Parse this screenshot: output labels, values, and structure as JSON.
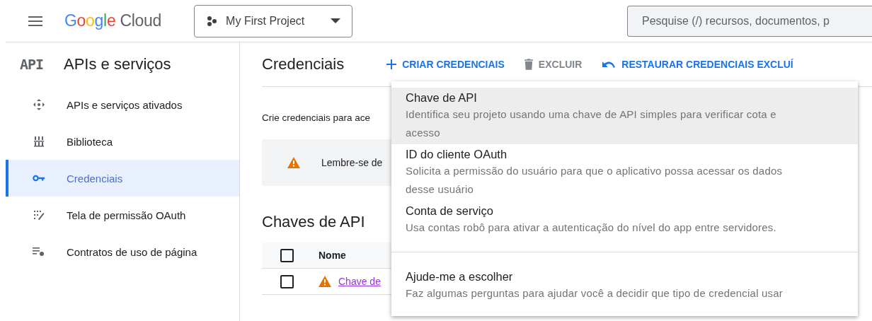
{
  "header": {
    "logo": {
      "brand": "Google",
      "product": "Cloud"
    },
    "project": "My First Project",
    "search": {
      "placeholder": "Pesquise (/) recursos, documentos, p"
    }
  },
  "sidebar": {
    "badge": "API",
    "title": "APIs e serviços",
    "items": [
      {
        "label": "APIs e serviços ativados",
        "selected": false
      },
      {
        "label": "Biblioteca",
        "selected": false
      },
      {
        "label": "Credenciais",
        "selected": true
      },
      {
        "label": "Tela de permissão OAuth",
        "selected": false
      },
      {
        "label": "Contratos de uso de página",
        "selected": false
      }
    ]
  },
  "main": {
    "title": "Credenciais",
    "toolbar": [
      {
        "label": "CRIAR CREDENCIAIS",
        "disabled": false
      },
      {
        "label": "EXCLUIR",
        "disabled": true
      },
      {
        "label": "RESTAURAR CREDENCIAIS EXCLUÍ",
        "disabled": false
      }
    ],
    "intro": "Crie credenciais para ace",
    "notice": "Lembre-se de",
    "section": "Chaves de API",
    "table": {
      "columns": [
        "Nome"
      ],
      "header_checked": false,
      "rows": [
        {
          "name": "Chave de",
          "checked": false,
          "warning": true
        }
      ]
    }
  },
  "menu": {
    "groups": [
      [
        {
          "title": "Chave de API",
          "description": "Identifica seu projeto usando uma chave de API simples para verificar cota e acesso",
          "selected": true
        },
        {
          "title": "ID do cliente OAuth",
          "description": "Solicita a permissão do usuário para que o aplicativo possa acessar os dados desse usuário",
          "selected": false
        },
        {
          "title": "Conta de serviço",
          "description": "Usa contas robô para ativar a autenticação do nível do app entre servidores.",
          "selected": false
        }
      ],
      [
        {
          "title": "Ajude-me a escolher",
          "description": "Faz algumas perguntas para ajudar você a decidir que tipo de credencial usar",
          "selected": false
        }
      ]
    ]
  }
}
